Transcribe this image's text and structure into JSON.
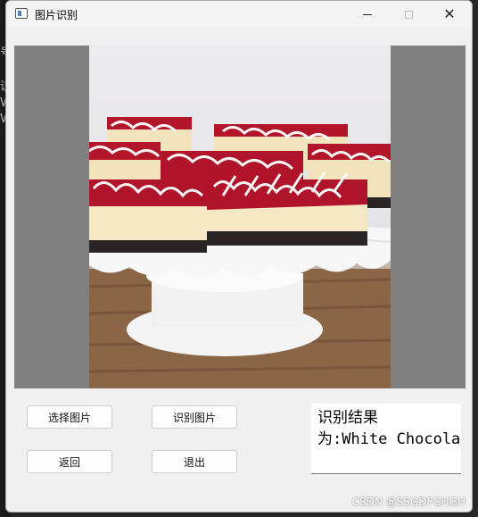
{
  "window": {
    "title": "图片识别"
  },
  "buttons": {
    "select_image": "选择图片",
    "recognize_image": "识别图片",
    "back": "返回",
    "exit": "退出"
  },
  "result": {
    "line1": "识别结果",
    "line2": "为:White Chocolate"
  },
  "background_fragments": [
    "号",
    "识",
    "V",
    "V"
  ],
  "watermark": "CSDN @SSGDFGHGH"
}
